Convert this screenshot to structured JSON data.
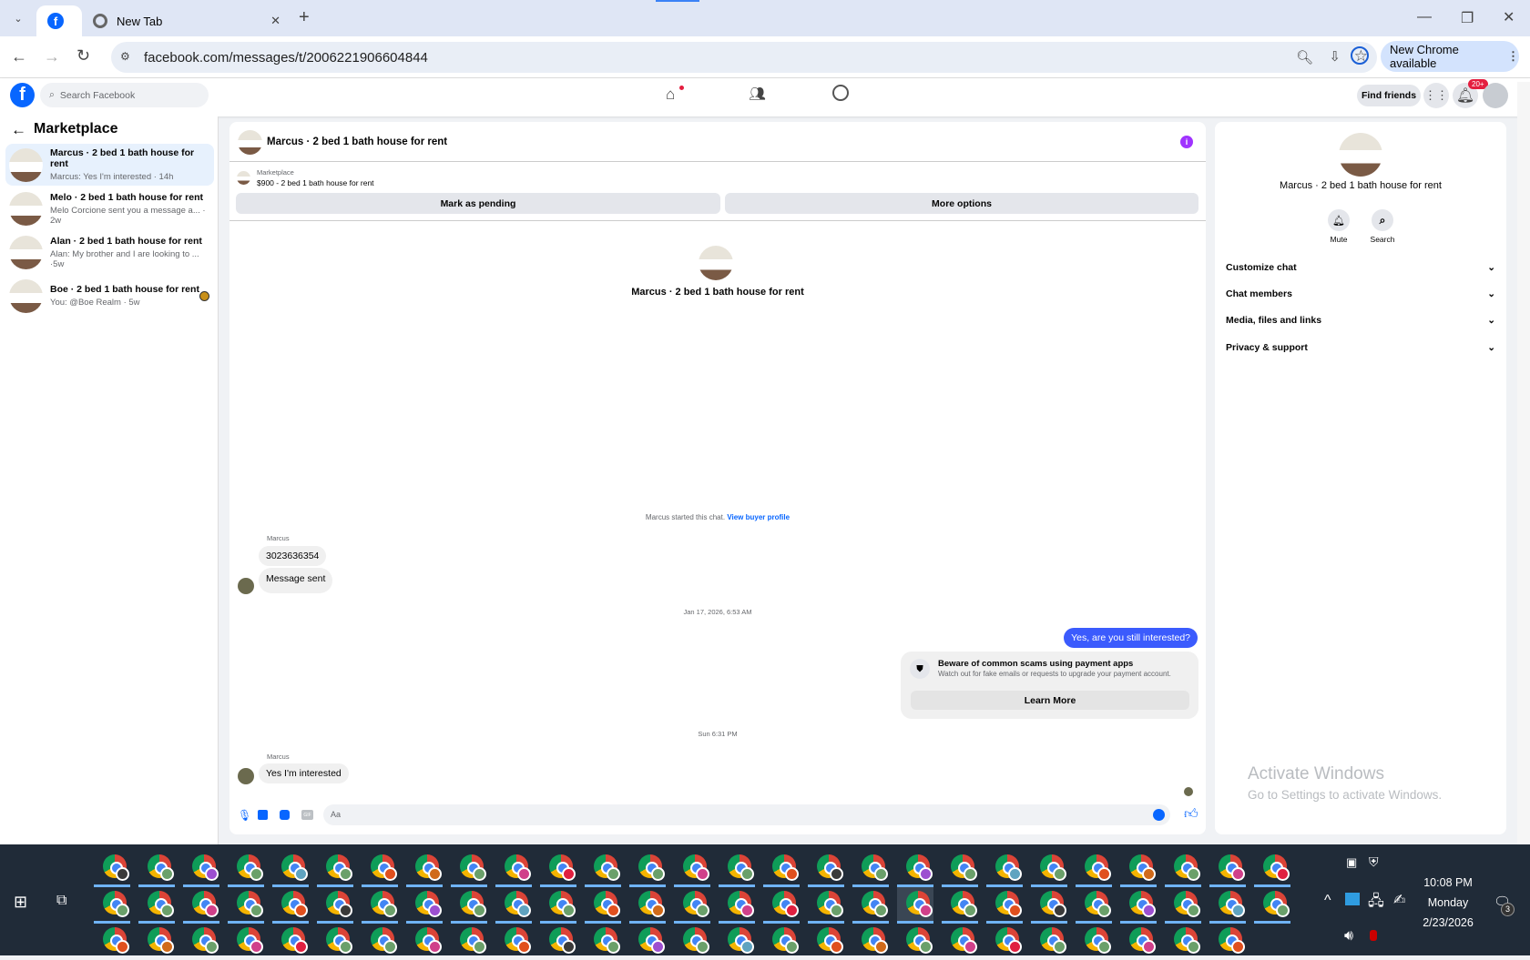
{
  "browser": {
    "tabs": [
      {
        "label": "",
        "icon": "facebook-icon",
        "active": true
      },
      {
        "label": "New Tab",
        "icon": "chrome-icon",
        "active": false
      }
    ],
    "url": "facebook.com/messages/t/2006221906604844",
    "update_label": "New Chrome available"
  },
  "fb": {
    "search_placeholder": "Search Facebook",
    "find_friends": "Find friends",
    "notif_badge": "20+",
    "brand_color": "#0866ff"
  },
  "sidebar": {
    "title": "Marketplace",
    "conversations": [
      {
        "title": "Marcus · 2 bed 1 bath house for rent",
        "snippet": "Marcus: Yes I'm interested · 14h",
        "selected": true
      },
      {
        "title": "Melo · 2 bed 1 bath house for rent",
        "snippet": "Melo Corcione sent you a message a... · 2w"
      },
      {
        "title": "Alan · 2 bed 1 bath house for rent",
        "snippet": "Alan: My brother and I are looking to ... ·5w"
      },
      {
        "title": "Boe · 2 bed 1 bath house for rent",
        "snippet": "You: @Boe Realm · 5w"
      }
    ]
  },
  "chat": {
    "title": "Marcus · 2 bed 1 bath house for rent",
    "listing_source": "Marketplace",
    "listing": "$900 - 2 bed 1 bath house for rent",
    "mark_pending": "Mark as pending",
    "more_options": "More options",
    "intro_name": "Marcus · 2 bed 1 bath house for rent",
    "started": "Marcus started this chat.",
    "view_profile": "View buyer profile",
    "sender1": "Marcus",
    "msg1": "3023636354",
    "msg2": "Message sent",
    "date1": "Jan 17, 2026, 6:53 AM",
    "out_msg": "Yes, are you still interested?",
    "warn_title": "Beware of common scams using payment apps",
    "warn_body": "Watch out for fake emails or requests to upgrade your payment account.",
    "learn_more": "Learn More",
    "date2": "Sun 6:31 PM",
    "sender2": "Marcus",
    "msg3": "Yes I'm interested",
    "composer_placeholder": "Aa",
    "outgoing_color": "#3b5bfd"
  },
  "details": {
    "name": "Marcus · 2 bed 1 bath house for rent",
    "mute": "Mute",
    "search": "Search",
    "sections": [
      "Customize chat",
      "Chat members",
      "Media, files and links",
      "Privacy & support"
    ]
  },
  "watermark": {
    "title": "Activate Windows",
    "body": "Go to Settings to activate Windows."
  },
  "taskbar": {
    "time": "10:08 PM",
    "day": "Monday",
    "date": "2/23/2026",
    "notif_count": "3",
    "profile_colors": [
      "#3a3a3a",
      "#6aa06a",
      "#9c4fd0",
      "#6aa06a",
      "#5fa3c0",
      "#6aa06a",
      "#e0501e",
      "#d06a1a",
      "#6aa06a",
      "#d0408a",
      "#e02040",
      "#6aa06a",
      "#6aa06a",
      "#d0408a",
      "#6aa06a",
      "#e0501e"
    ]
  }
}
